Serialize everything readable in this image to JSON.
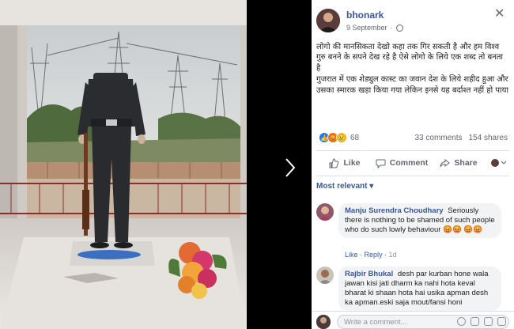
{
  "post": {
    "author": "bhonark",
    "date": "9 September",
    "privacy_icon": "globe-icon",
    "text_lines": [
      "लोगो की मानसिकता देखो कहा तक गिर सकती है और हम विश्व गुरु बनने के सपने देख रहे है ऐसे लोगो के लिये एक शब्द तो बनता है",
      "गुजरात में एक शेड्युल कास्ट का जवान देश के लिये शहीद हुआ और उसका स्मारक खड़ा किया गया लेकिन इनसे यह बर्दाश्त नहीं हो पाया"
    ]
  },
  "reactions": {
    "count": "68",
    "types": [
      "like",
      "angry",
      "sad"
    ],
    "comments": "33 comments",
    "shares": "154 shares"
  },
  "actions": {
    "like": "Like",
    "comment": "Comment",
    "share": "Share"
  },
  "sort": {
    "label": "Most relevant ▾"
  },
  "comments": [
    {
      "name": "Manju Surendra Choudhary",
      "text": "Seriously there is nothing to be shamed of such people who do such lowly behaviour",
      "like": "Like",
      "reply": "Reply",
      "time": "1d"
    },
    {
      "name": "Rajbir Bhukal",
      "text": "desh par kurban hone wala jawan kisi jati dharm ka nahi hota keval bharat ki shaan hota hai usika apman desh ka apman.eski saja mout/fansi honi"
    }
  ],
  "composer": {
    "placeholder": "Write a comment..."
  },
  "colors": {
    "link": "#385898",
    "like": "#1877f2",
    "angry": "#e9710f",
    "sad": "#f7b125",
    "bubble": "#f2f3f5"
  }
}
